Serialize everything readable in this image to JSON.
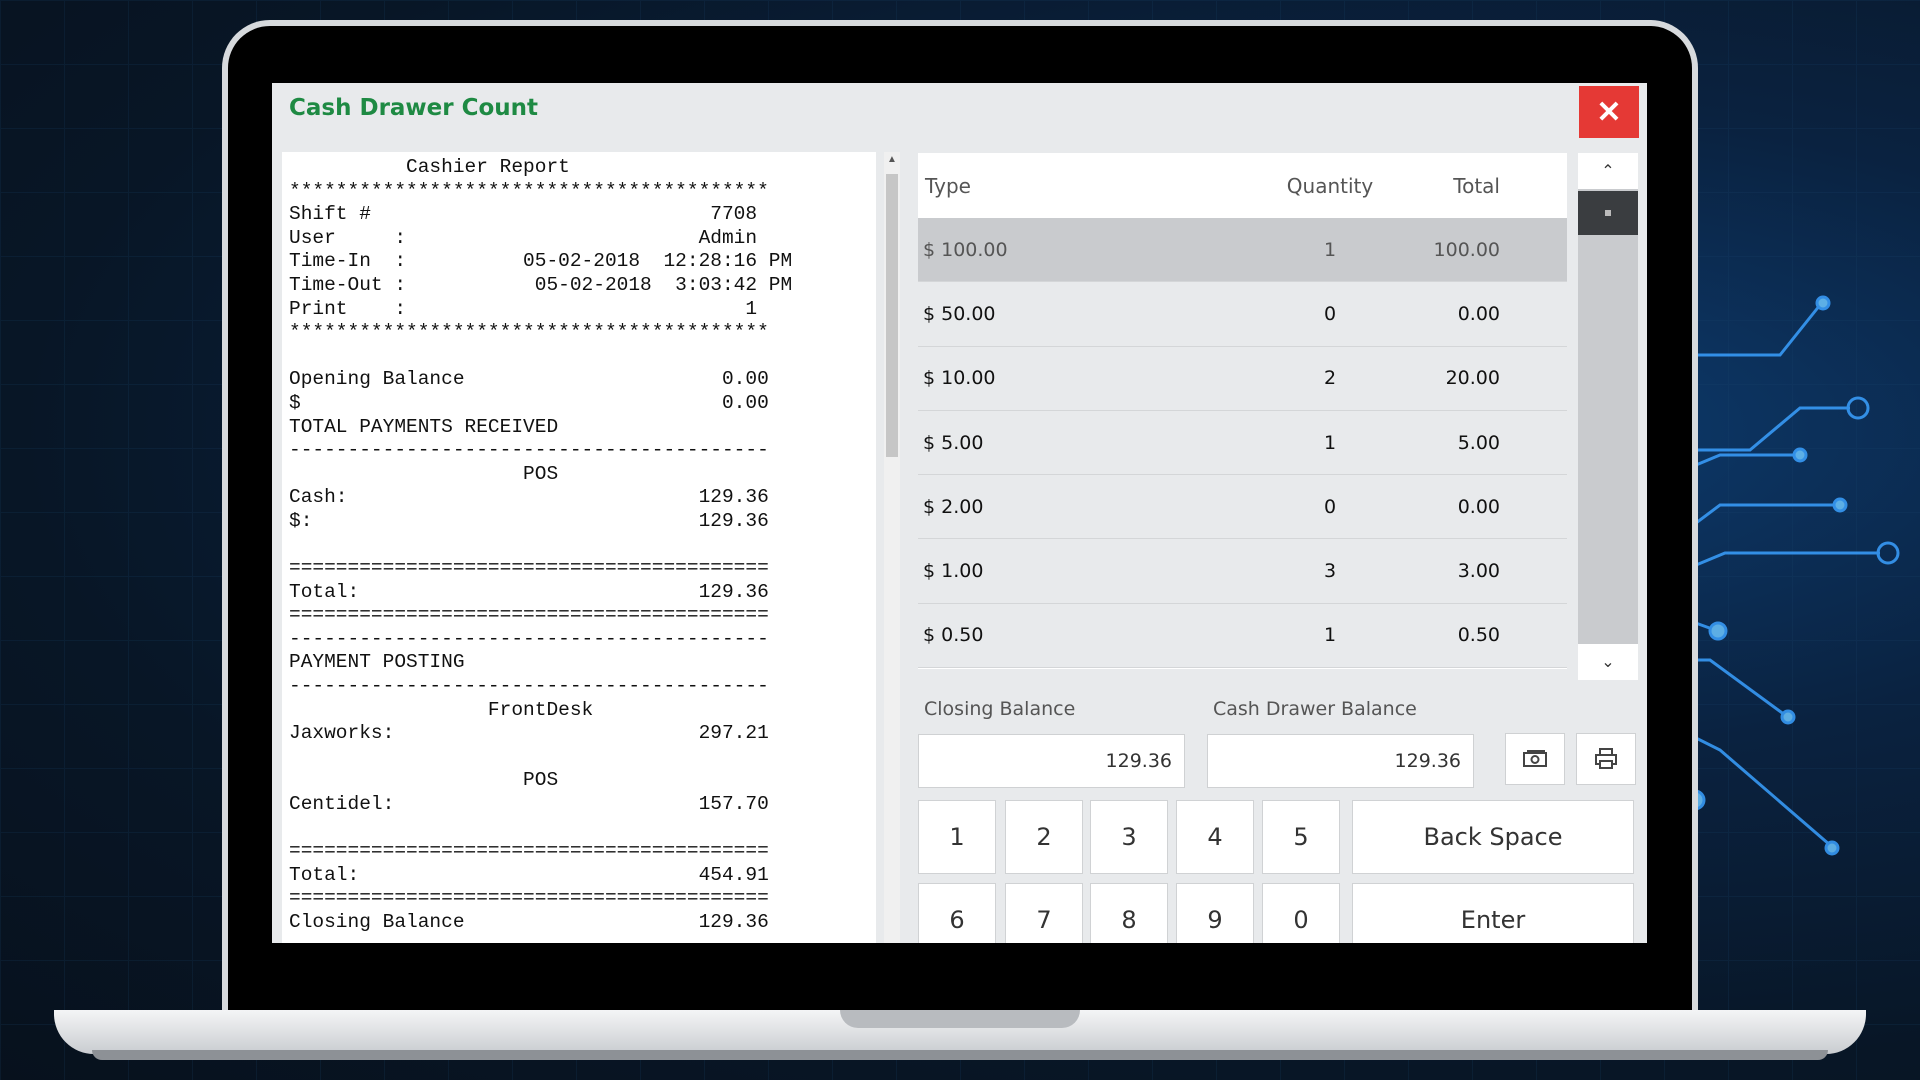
{
  "window": {
    "title": "Cash Drawer Count",
    "close_glyph": "✕",
    "close_icon": "close-icon"
  },
  "report": {
    "text": "          Cashier Report\n*****************************************\nShift #                             7708\nUser     :                         Admin\nTime-In  :          05-02-2018  12:28:16 PM\nTime-Out :           05-02-2018  3:03:42 PM\nPrint    :                             1\n*****************************************\n\nOpening Balance                      0.00\n$                                    0.00\nTOTAL PAYMENTS RECEIVED\n-----------------------------------------\n                    POS\nCash:                              129.36\n$:                                 129.36\n\n=========================================\nTotal:                             129.36\n=========================================\n-----------------------------------------\nPAYMENT POSTING\n-----------------------------------------\n                 FrontDesk\nJaxworks:                          297.21\n\n                    POS\nCentidel:                          157.70\n\n=========================================\nTotal:                             454.91\n=========================================\nClosing Balance                    129.36"
  },
  "denominations": {
    "headers": {
      "type": "Type",
      "quantity": "Quantity",
      "total": "Total"
    },
    "rows": [
      {
        "type": "$ 100.00",
        "quantity": "1",
        "total": "100.00",
        "selected": true
      },
      {
        "type": "$ 50.00",
        "quantity": "0",
        "total": "0.00",
        "selected": false
      },
      {
        "type": "$ 10.00",
        "quantity": "2",
        "total": "20.00",
        "selected": false
      },
      {
        "type": "$ 5.00",
        "quantity": "1",
        "total": "5.00",
        "selected": false
      },
      {
        "type": "$ 2.00",
        "quantity": "0",
        "total": "0.00",
        "selected": false
      },
      {
        "type": "$ 1.00",
        "quantity": "3",
        "total": "3.00",
        "selected": false
      },
      {
        "type": "$ 0.50",
        "quantity": "1",
        "total": "0.50",
        "selected": false
      }
    ],
    "scroll_up_glyph": "⌃",
    "scroll_down_glyph": "⌄"
  },
  "balances": {
    "closing_label": "Closing Balance",
    "closing_value": "129.36",
    "drawer_label": "Cash Drawer Balance",
    "drawer_value": "129.36",
    "cash_icon": "cash-icon",
    "printer_icon": "printer-icon"
  },
  "keypad": {
    "digits_row1": [
      "1",
      "2",
      "3",
      "4",
      "5"
    ],
    "digits_row2": [
      "6",
      "7",
      "8",
      "9",
      "0"
    ],
    "backspace_label": "Back Space",
    "enter_label": "Enter"
  },
  "colors": {
    "title": "#1e8a43",
    "close": "#e53935",
    "selected_row": "#c9cbce",
    "scroll_thumb": "#3a3d40"
  }
}
